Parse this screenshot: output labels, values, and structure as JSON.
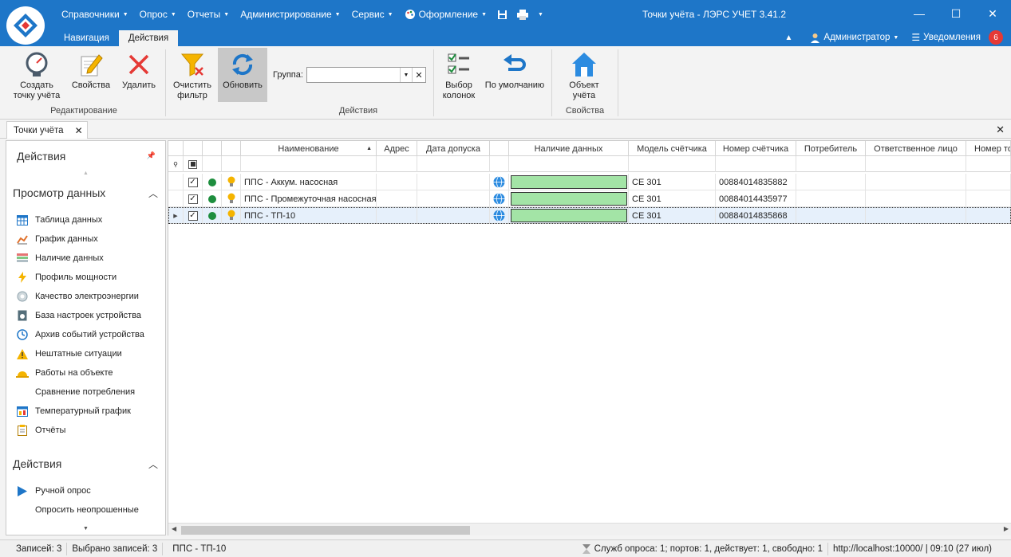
{
  "titlebar": {
    "title": "Точки учёта - ЛЭРС УЧЕТ 3.41.2",
    "menu": [
      "Справочники",
      "Опрос",
      "Отчеты",
      "Администрирование",
      "Сервис",
      "Оформление"
    ],
    "tabs": [
      "Навигация",
      "Действия"
    ],
    "active_tab": "Действия",
    "user": "Администратор",
    "notifications_label": "Уведомления",
    "notifications_count": "6"
  },
  "ribbon": {
    "edit": {
      "create": "Создать\nточку учёта",
      "properties": "Свойства",
      "delete": "Удалить",
      "label": "Редактирование"
    },
    "actions": {
      "clear_filter": "Очистить\nфильтр",
      "refresh": "Обновить",
      "group_label": "Группа:",
      "group_value": "",
      "columns": "Выбор\nколонок",
      "default": "По умолчанию",
      "label": "Действия"
    },
    "props": {
      "object": "Объект\nучёта",
      "label": "Свойства"
    }
  },
  "doctab": {
    "label": "Точки учёта"
  },
  "side": {
    "title": "Действия",
    "view_header": "Просмотр данных",
    "view_items": [
      {
        "label": "Таблица данных",
        "icon": "table-icon"
      },
      {
        "label": "График данных",
        "icon": "chart-icon"
      },
      {
        "label": "Наличие данных",
        "icon": "availability-icon"
      },
      {
        "label": "Профиль мощности",
        "icon": "lightning-icon"
      },
      {
        "label": "Качество электроэнергии",
        "icon": "quality-icon"
      },
      {
        "label": "База настроек устройства",
        "icon": "device-settings-icon"
      },
      {
        "label": "Архив событий устройства",
        "icon": "event-archive-icon"
      },
      {
        "label": "Нештатные ситуации",
        "icon": "warning-icon"
      },
      {
        "label": "Работы на объекте",
        "icon": "hard-hat-icon"
      },
      {
        "label": "Сравнение потребления",
        "icon": "compare-icon"
      },
      {
        "label": "Температурный график",
        "icon": "temperature-icon"
      },
      {
        "label": "Отчёты",
        "icon": "report-icon"
      }
    ],
    "actions_header": "Действия",
    "action_items": [
      {
        "label": "Ручной опрос",
        "icon": "play-icon"
      },
      {
        "label": "Опросить неопрошенные",
        "icon": "poll-icon"
      }
    ]
  },
  "grid": {
    "columns": [
      "Наименование",
      "Адрес",
      "Дата допуска",
      "Наличие данных",
      "Модель счётчика",
      "Номер счётчика",
      "Потребитель",
      "Ответственное лицо",
      "Номер то"
    ],
    "rows": [
      {
        "name": "ППС - Аккум. насосная",
        "model": "CE 301",
        "number": "00884014835882",
        "selected": false
      },
      {
        "name": "ППС - Промежуточная насосная",
        "model": "CE 301",
        "number": "00884014435977",
        "selected": false
      },
      {
        "name": "ППС - ТП-10",
        "model": "CE 301",
        "number": "00884014835868",
        "selected": true
      }
    ]
  },
  "status": {
    "records": "Записей: 3",
    "selected": "Выбрано записей: 3",
    "current": "ППС - ТП-10",
    "services": "Служб опроса: 1; портов: 1, действует: 1, свободно: 1",
    "server": "http://localhost:10000/ | 09:10 (27 июл)"
  },
  "colors": {
    "titlebar": "#1e76c8",
    "data_bar": "#a3e4a6",
    "badge": "#e53935"
  }
}
